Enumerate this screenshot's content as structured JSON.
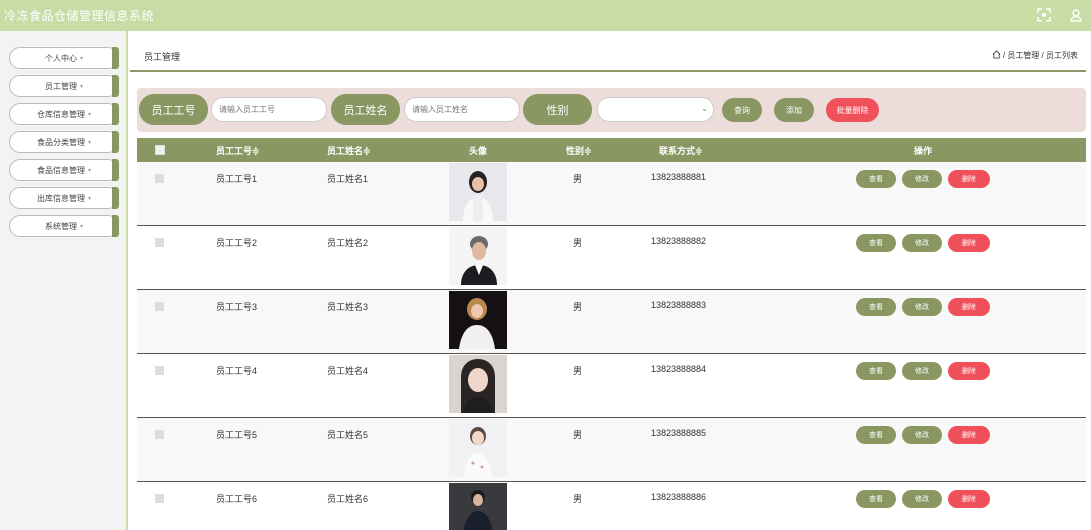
{
  "app": {
    "title": "冷冻食品仓储管理信息系统"
  },
  "sidebar": {
    "items": [
      {
        "label": "个人中心"
      },
      {
        "label": "员工管理"
      },
      {
        "label": "仓库信息管理"
      },
      {
        "label": "食品分类管理"
      },
      {
        "label": "食品信息管理"
      },
      {
        "label": "出库信息管理"
      },
      {
        "label": "系统管理"
      }
    ]
  },
  "breadcrumb": {
    "title": "员工管理",
    "path": "/ 员工管理 / 员工列表"
  },
  "search": {
    "id_label": "员工工号",
    "id_placeholder": "请输入员工工号",
    "name_label": "员工姓名",
    "name_placeholder": "请输入员工姓名",
    "gender_label": "性别",
    "gender_value": "",
    "query_button": "查询",
    "add_button": "添加",
    "batch_delete_button": "批量删除"
  },
  "table": {
    "headers": {
      "id": "员工工号",
      "name": "员工姓名",
      "avatar": "头像",
      "gender": "性别",
      "phone": "联系方式",
      "actions": "操作"
    },
    "sort_mark": "≑",
    "actions": {
      "view": "查看",
      "edit": "修改",
      "delete": "删除"
    },
    "rows": [
      {
        "id": "员工工号1",
        "name": "员工姓名1",
        "gender": "男",
        "phone": "13823888881"
      },
      {
        "id": "员工工号2",
        "name": "员工姓名2",
        "gender": "男",
        "phone": "13823888882"
      },
      {
        "id": "员工工号3",
        "name": "员工姓名3",
        "gender": "男",
        "phone": "13823888883"
      },
      {
        "id": "员工工号4",
        "name": "员工姓名4",
        "gender": "男",
        "phone": "13823888884"
      },
      {
        "id": "员工工号5",
        "name": "员工姓名5",
        "gender": "男",
        "phone": "13823888885"
      },
      {
        "id": "员工工号6",
        "name": "员工姓名6",
        "gender": "男",
        "phone": "13823888886"
      }
    ]
  },
  "colors": {
    "accent": "#8a9763",
    "header": "#c8dca6",
    "danger": "#f0505a",
    "search_bg": "#ecdcda"
  },
  "icons": {
    "fullscreen": "fullscreen-icon",
    "user": "user-icon",
    "home": "home-icon",
    "caret": "chevron-down-icon"
  }
}
